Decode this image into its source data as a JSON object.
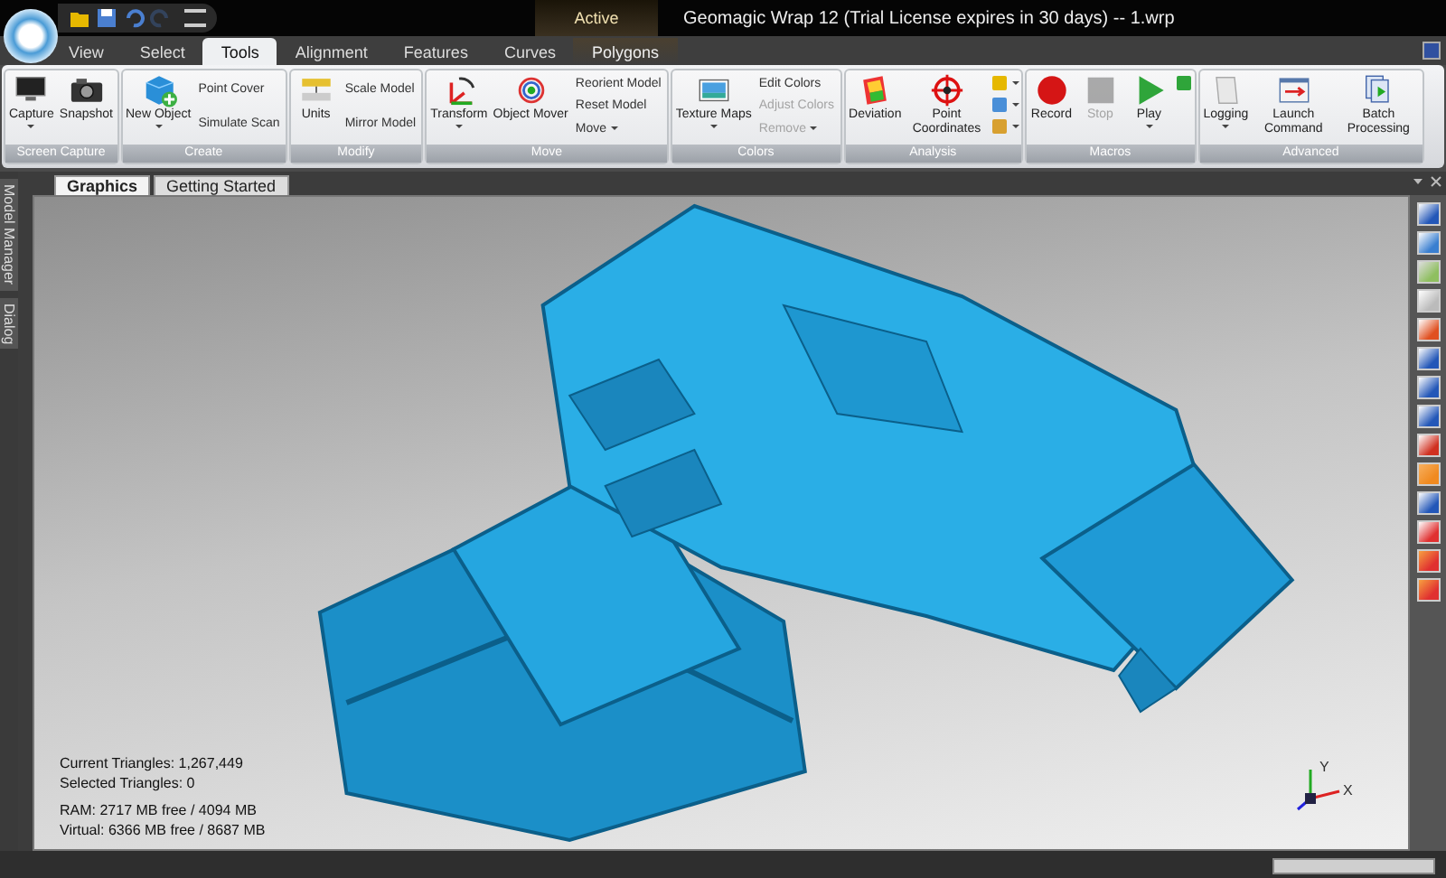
{
  "title_bar": {
    "quick_access": [
      {
        "disabled": false
      },
      {
        "disabled": false
      },
      {
        "disabled": false
      },
      {
        "disabled": true
      }
    ],
    "context_label": "Active",
    "title": "Geomagic Wrap 12 (Trial License expires in 30 days) -- 1.wrp"
  },
  "tabs": [
    {
      "label": "View",
      "selected": false,
      "contextual": false
    },
    {
      "label": "Select",
      "selected": false,
      "contextual": false
    },
    {
      "label": "Tools",
      "selected": true,
      "contextual": false
    },
    {
      "label": "Alignment",
      "selected": false,
      "contextual": false
    },
    {
      "label": "Features",
      "selected": false,
      "contextual": false
    },
    {
      "label": "Curves",
      "selected": false,
      "contextual": false
    },
    {
      "label": "Polygons",
      "selected": false,
      "contextual": true
    }
  ],
  "ribbon": [
    {
      "name": "Screen Capture",
      "items": [
        {
          "kind": "large",
          "label": "Capture",
          "dropdown": true,
          "disabled": false
        },
        {
          "kind": "large",
          "label": "Snapshot",
          "dropdown": false,
          "disabled": false
        }
      ]
    },
    {
      "name": "Create",
      "items": [
        {
          "kind": "large",
          "label": "New Object",
          "dropdown": true,
          "disabled": false
        },
        {
          "kind": "small",
          "labels": [
            {
              "label": "Point Cover",
              "dropdown": false,
              "disabled": false
            },
            {
              "label": "Simulate Scan",
              "dropdown": false,
              "disabled": false
            }
          ]
        }
      ]
    },
    {
      "name": "Modify",
      "items": [
        {
          "kind": "large",
          "label": "Units",
          "dropdown": false,
          "disabled": false
        },
        {
          "kind": "small",
          "labels": [
            {
              "label": "Scale Model",
              "dropdown": false,
              "disabled": false
            },
            {
              "label": "Mirror Model",
              "dropdown": false,
              "disabled": false
            }
          ]
        }
      ]
    },
    {
      "name": "Move",
      "items": [
        {
          "kind": "large",
          "label": "Transform",
          "dropdown": true,
          "disabled": false
        },
        {
          "kind": "large",
          "label": "Object Mover",
          "dropdown": false,
          "disabled": false
        },
        {
          "kind": "small",
          "labels": [
            {
              "label": "Reorient Model",
              "dropdown": false,
              "disabled": false
            },
            {
              "label": "Reset Model",
              "dropdown": false,
              "disabled": false
            },
            {
              "label": "Move",
              "dropdown": true,
              "disabled": false
            }
          ]
        }
      ]
    },
    {
      "name": "Colors",
      "items": [
        {
          "kind": "large",
          "label": "Texture Maps",
          "dropdown": true,
          "disabled": false
        },
        {
          "kind": "small",
          "labels": [
            {
              "label": "Edit Colors",
              "dropdown": false,
              "disabled": false
            },
            {
              "label": "Adjust Colors",
              "dropdown": false,
              "disabled": true
            },
            {
              "label": "Remove",
              "dropdown": true,
              "disabled": true
            }
          ]
        }
      ]
    },
    {
      "name": "Analysis",
      "items": [
        {
          "kind": "large",
          "label": "Deviation",
          "dropdown": false,
          "disabled": false
        },
        {
          "kind": "large",
          "label": "Point Coordinates",
          "dropdown": false,
          "disabled": false
        },
        {
          "kind": "icons",
          "buttons": [
            {
              "dropdown": true
            },
            {
              "dropdown": true
            },
            {
              "dropdown": true
            }
          ]
        }
      ]
    },
    {
      "name": "Macros",
      "items": [
        {
          "kind": "large",
          "label": "Record",
          "dropdown": false,
          "disabled": false
        },
        {
          "kind": "large",
          "label": "Stop",
          "dropdown": false,
          "disabled": true
        },
        {
          "kind": "large",
          "label": "Play",
          "dropdown": true,
          "disabled": false
        },
        {
          "kind": "icons",
          "buttons": [
            {
              "dropdown": false
            }
          ]
        }
      ]
    },
    {
      "name": "Advanced",
      "items": [
        {
          "kind": "large",
          "label": "Logging",
          "dropdown": true,
          "disabled": false
        },
        {
          "kind": "large",
          "label": "Launch Command",
          "dropdown": false,
          "disabled": false
        },
        {
          "kind": "large",
          "label": "Batch Processing",
          "dropdown": false,
          "disabled": false
        }
      ]
    }
  ],
  "side_panels": [
    "Model Manager",
    "Dialog"
  ],
  "document_tabs": [
    {
      "label": "Graphics",
      "selected": true
    },
    {
      "label": "Getting Started",
      "selected": false
    }
  ],
  "viewport": {
    "stats": [
      {
        "lines": [
          "Current Triangles: 1,267,449",
          "Selected Triangles: 0"
        ]
      },
      {
        "lines": [
          "RAM: 2717 MB free / 4094 MB",
          "Virtual: 6366 MB free / 8687 MB"
        ]
      }
    ],
    "axes": [
      "Y",
      "X"
    ]
  }
}
